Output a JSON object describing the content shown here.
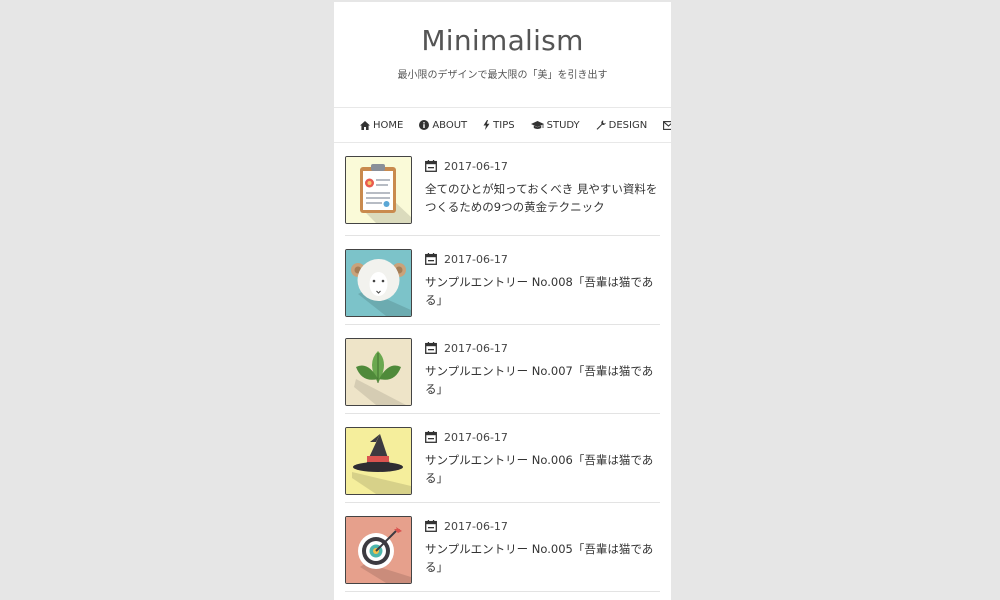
{
  "site": {
    "title": "Minimalism",
    "tagline": "最小限のデザインで最大限の「美」を引き出す"
  },
  "nav": {
    "items": [
      {
        "label": "HOME",
        "icon": "home-icon"
      },
      {
        "label": "ABOUT",
        "icon": "info-circle-icon"
      },
      {
        "label": "TIPS",
        "icon": "bolt-icon"
      },
      {
        "label": "STUDY",
        "icon": "graduation-cap-icon"
      },
      {
        "label": "DESIGN",
        "icon": "wrench-icon"
      },
      {
        "label": "",
        "icon": "envelope-icon"
      }
    ]
  },
  "entries": [
    {
      "date": "2017-06-17",
      "title": "全てのひとが知っておくべき 見やすい資料をつくるための9つの黄金テクニック",
      "thumb": "certificate",
      "thumb_bg": "#fafad8"
    },
    {
      "date": "2017-06-17",
      "title": "サンプルエントリー No.008「吾輩は猫である」",
      "thumb": "sheep",
      "thumb_bg": "#7cc3c9"
    },
    {
      "date": "2017-06-17",
      "title": "サンプルエントリー No.007「吾輩は猫である」",
      "thumb": "leaves",
      "thumb_bg": "#eee4c8"
    },
    {
      "date": "2017-06-17",
      "title": "サンプルエントリー No.006「吾輩は猫である」",
      "thumb": "witch-hat",
      "thumb_bg": "#f5ee9c"
    },
    {
      "date": "2017-06-17",
      "title": "サンプルエントリー No.005「吾輩は猫である」",
      "thumb": "target",
      "thumb_bg": "#e6a08c"
    }
  ]
}
